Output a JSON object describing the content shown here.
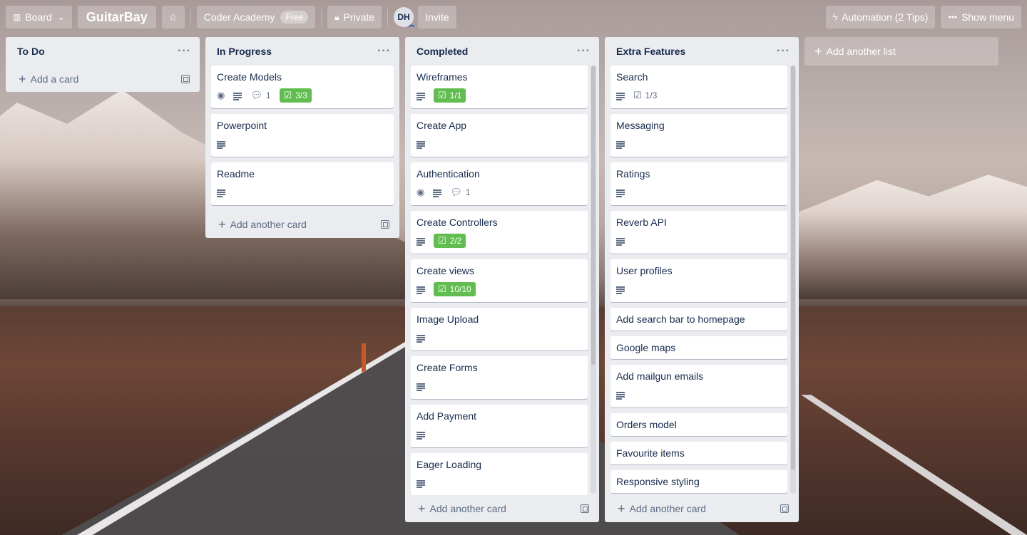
{
  "header": {
    "board_button": "Board",
    "board_title": "GuitarBay",
    "workspace": "Coder Academy",
    "workspace_badge": "Free",
    "visibility": "Private",
    "avatar_initials": "DH",
    "invite": "Invite",
    "automation": "Automation (2 Tips)",
    "show_menu": "Show menu"
  },
  "lists": [
    {
      "title": "To Do",
      "cards": [],
      "add_label": "Add a card"
    },
    {
      "title": "In Progress",
      "cards": [
        {
          "title": "Create Models",
          "watch": true,
          "desc": true,
          "comments": "1",
          "checklist": "3/3",
          "complete": true
        },
        {
          "title": "Powerpoint",
          "desc": true
        },
        {
          "title": "Readme",
          "desc": true
        }
      ],
      "add_label": "Add another card"
    },
    {
      "title": "Completed",
      "cards": [
        {
          "title": "Wireframes",
          "desc": true,
          "checklist": "1/1",
          "complete": true
        },
        {
          "title": "Create App",
          "desc": true
        },
        {
          "title": "Authentication",
          "watch": true,
          "desc": true,
          "comments": "1"
        },
        {
          "title": "Create Controllers",
          "desc": true,
          "checklist": "2/2",
          "complete": true
        },
        {
          "title": "Create views",
          "desc": true,
          "checklist": "10/10",
          "complete": true
        },
        {
          "title": "Image Upload",
          "desc": true
        },
        {
          "title": "Create Forms",
          "desc": true
        },
        {
          "title": "Add Payment",
          "desc": true
        },
        {
          "title": "Eager Loading",
          "desc": true
        }
      ],
      "add_label": "Add another card"
    },
    {
      "title": "Extra Features",
      "cards": [
        {
          "title": "Search",
          "desc": true,
          "checklist": "1/3",
          "complete": false
        },
        {
          "title": "Messaging",
          "desc": true
        },
        {
          "title": "Ratings",
          "desc": true
        },
        {
          "title": "Reverb API",
          "desc": true
        },
        {
          "title": "User profiles",
          "desc": true
        },
        {
          "title": "Add search bar to homepage"
        },
        {
          "title": "Google maps"
        },
        {
          "title": "Add mailgun emails",
          "desc": true
        },
        {
          "title": "Orders model"
        },
        {
          "title": "Favourite items"
        },
        {
          "title": "Responsive styling"
        }
      ],
      "add_label": "Add another card"
    }
  ],
  "add_list_label": "Add another list"
}
